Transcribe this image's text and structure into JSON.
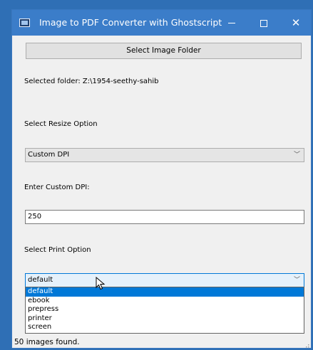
{
  "window": {
    "title": "Image to PDF Converter with Ghostscript",
    "icons": {
      "app": "app-icon",
      "minimize": "minimize-icon",
      "maximize": "maximize-icon",
      "close": "close-icon"
    }
  },
  "folder": {
    "button_label": "Select Image Folder",
    "selected_text": "Selected folder: Z:\\1954-seethy-sahib"
  },
  "resize": {
    "label": "Select Resize Option",
    "value": "Custom DPI"
  },
  "dpi": {
    "label": "Enter Custom DPI:",
    "value": "250"
  },
  "print": {
    "label": "Select Print Option",
    "value": "default",
    "options": [
      "default",
      "ebook",
      "prepress",
      "printer",
      "screen"
    ]
  },
  "status": {
    "text": "50 images found."
  },
  "colors": {
    "titlebar": "#3b7dc9",
    "selection": "#0078d7"
  }
}
